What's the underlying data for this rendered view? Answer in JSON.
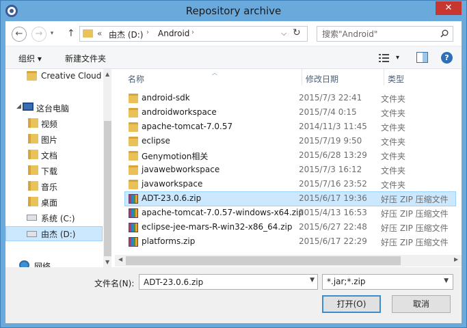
{
  "window": {
    "title": "Repository archive",
    "close_glyph": "✕"
  },
  "address": {
    "back_glyph": "←",
    "forward_glyph": "→",
    "up_glyph": "↑",
    "path_prefix": "«",
    "path_segments": [
      "由杰 (D:)",
      "Android"
    ],
    "path_separator": "›",
    "dropdown_glyph": "⌵",
    "refresh_glyph": "↻",
    "search_placeholder": "搜索\"Android\""
  },
  "toolbar": {
    "organize_label": "组织 ▾",
    "new_folder_label": "新建文件夹",
    "view_dropdown_glyph": "▾",
    "help_glyph": "?"
  },
  "sidebar": {
    "items": [
      {
        "label": "Creative Cloud",
        "icon": "folder-icon",
        "indent": 1
      },
      {
        "label": "这台电脑",
        "icon": "computer-icon",
        "indent": 0,
        "caret": "◢"
      },
      {
        "label": "视频",
        "icon": "videos-folder-icon",
        "indent": 2
      },
      {
        "label": "图片",
        "icon": "pictures-folder-icon",
        "indent": 2
      },
      {
        "label": "文档",
        "icon": "documents-folder-icon",
        "indent": 2
      },
      {
        "label": "下载",
        "icon": "downloads-folder-icon",
        "indent": 2
      },
      {
        "label": "音乐",
        "icon": "music-folder-icon",
        "indent": 2
      },
      {
        "label": "桌面",
        "icon": "desktop-folder-icon",
        "indent": 2
      },
      {
        "label": "系统 (C:)",
        "icon": "windows-drive-icon",
        "indent": 2
      },
      {
        "label": "由杰 (D:)",
        "icon": "drive-icon",
        "indent": 2,
        "selected": true
      },
      {
        "label": "网络",
        "icon": "network-icon",
        "indent": 1
      }
    ]
  },
  "columns": {
    "name": "名称",
    "date": "修改日期",
    "type": "类型"
  },
  "files": [
    {
      "name": "android-sdk",
      "date": "2015/7/3 22:41",
      "type": "文件夹",
      "kind": "folder"
    },
    {
      "name": "androidworkspace",
      "date": "2015/7/4 0:15",
      "type": "文件夹",
      "kind": "folder"
    },
    {
      "name": "apache-tomcat-7.0.57",
      "date": "2014/11/3 11:45",
      "type": "文件夹",
      "kind": "folder"
    },
    {
      "name": "eclipse",
      "date": "2015/7/19 9:50",
      "type": "文件夹",
      "kind": "folder"
    },
    {
      "name": "Genymotion相关",
      "date": "2015/6/28 13:29",
      "type": "文件夹",
      "kind": "folder"
    },
    {
      "name": "javawebworkspace",
      "date": "2015/7/3 16:12",
      "type": "文件夹",
      "kind": "folder"
    },
    {
      "name": "javaworkspace",
      "date": "2015/7/16 23:52",
      "type": "文件夹",
      "kind": "folder"
    },
    {
      "name": "ADT-23.0.6.zip",
      "date": "2015/6/17 19:36",
      "type": "好压 ZIP 压缩文件",
      "kind": "zip",
      "selected": true
    },
    {
      "name": "apache-tomcat-7.0.57-windows-x64.zip",
      "date": "2015/4/13 16:53",
      "type": "好压 ZIP 压缩文件",
      "kind": "zip"
    },
    {
      "name": "eclipse-jee-mars-R-win32-x86_64.zip",
      "date": "2015/6/27 22:48",
      "type": "好压 ZIP 压缩文件",
      "kind": "zip"
    },
    {
      "name": "platforms.zip",
      "date": "2015/6/17 22:29",
      "type": "好压 ZIP 压缩文件",
      "kind": "zip"
    }
  ],
  "bottom": {
    "filename_label": "文件名(N):",
    "filename_value": "ADT-23.0.6.zip",
    "filetype_value": "*.jar;*.zip",
    "open_label": "打开(O)",
    "cancel_label": "取消"
  }
}
